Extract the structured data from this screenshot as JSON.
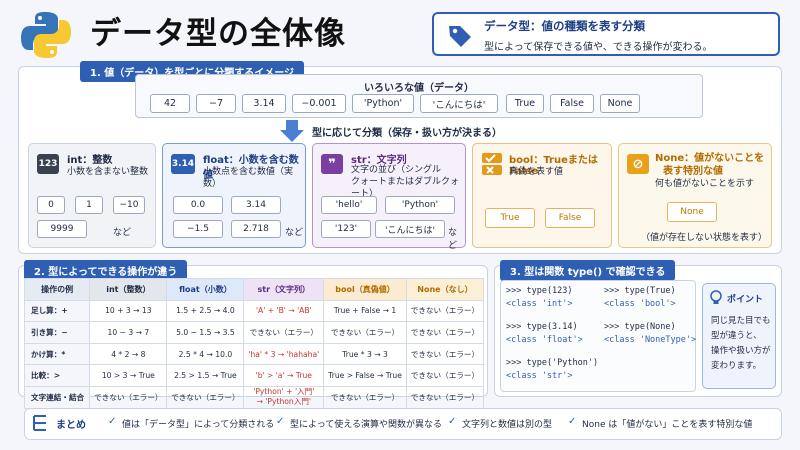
{
  "header": {
    "title": "データ型の全体像",
    "def_title": "データ型：値の種類を表す分類",
    "def_sub": "型によって保存できる値や、できる操作が変わる。"
  },
  "section1": {
    "label": "1. 値（データ）を型ごとに分類するイメージ",
    "values_heading": "いろいろな値（データ）",
    "values": [
      "42",
      "−7",
      "3.14",
      "−0.001",
      "'Python'",
      "'こんにちは'",
      "True",
      "False",
      "None"
    ],
    "arrow_text": "型に応じて分類（保存・扱い方が決まる）",
    "cards": {
      "int": {
        "icon": "123",
        "title": "int：整数",
        "desc": "小数を含まない整数",
        "vals": [
          "0",
          "1",
          "−10",
          "9999"
        ],
        "etc": "など"
      },
      "float": {
        "icon": "3.14",
        "title": "float：小数を含む数値",
        "desc": "小数点を含む数値（実数）",
        "vals": [
          "0.0",
          "3.14",
          "−1.5",
          "2.718"
        ],
        "etc": "など"
      },
      "str": {
        "title": "str：文字列",
        "desc1": "文字の並び（シングル",
        "desc2": "クォートまたはダブルクォート）",
        "vals": [
          "'hello'",
          "'Python'",
          "'123'",
          "'こんにちは'"
        ],
        "etc": "など"
      },
      "bool": {
        "title": "bool：TrueまたはFalse",
        "desc": "真偽を表す値",
        "vals": [
          "True",
          "False"
        ]
      },
      "none": {
        "title1": "None：値がないことを",
        "title2": "表す特別な値",
        "desc": "何も値がないことを示す",
        "val": "None",
        "note": "（値が存在しない状態を表す）"
      }
    }
  },
  "section2": {
    "label": "2. 型によってできる操作が違う",
    "headers": [
      "操作の例",
      "int（整数）",
      "float（小数）",
      "str（文字列）",
      "bool（真偽値）",
      "None（なし）"
    ],
    "rows": [
      [
        "足し算：+",
        "10 + 3 → 13",
        "1.5 + 2.5 → 4.0",
        "'A' + 'B' → 'AB'",
        "True + False → 1",
        "できない（エラー）"
      ],
      [
        "引き算：−",
        "10 − 3 → 7",
        "5.0 − 1.5 → 3.5",
        "できない（エラー）",
        "できない（エラー）",
        "できない（エラー）"
      ],
      [
        "かけ算：*",
        "4 * 2 → 8",
        "2.5 * 4 → 10.0",
        "'ha' * 3 → 'hahaha'",
        "True * 3 → 3",
        "できない（エラー）"
      ],
      [
        "比較：>",
        "10 > 3 → True",
        "2.5 > 1.5 → True",
        "'b' > 'a' → True",
        "True > False → True",
        "できない（エラー）"
      ],
      [
        "文字連結・結合",
        "できない（エラー）",
        "できない（エラー）",
        "'Python' + '入門'",
        "できない（エラー）",
        "できない（エラー）"
      ]
    ],
    "concat_result": "→ 'Python入門'"
  },
  "section3": {
    "label": "3. 型は関数 type() で確認できる",
    "code": {
      "l1": ">>> type(123)",
      "l1o": "<class 'int'>",
      "l2": ">>> type(3.14)",
      "l2o": "<class 'float'>",
      "l3": ">>> type('Python')",
      "l3o": "<class 'str'>",
      "r1": ">>> type(True)",
      "r1o": "<class 'bool'>",
      "r2": ">>> type(None)",
      "r2o": "<class 'NoneType'>"
    },
    "point_title": "ポイント",
    "point_lines": [
      "同じ見た目でも",
      "型が違うと、",
      "操作や扱い方が",
      "変わります。"
    ]
  },
  "summary": {
    "label": "まとめ",
    "items": [
      "値は「データ型」によって分類される",
      "型によって使える演算や関数が異なる",
      "文字列と数値は別の型",
      "None は「値がない」ことを表す特別な値"
    ]
  },
  "colors": {
    "primary": "#2f5fb3",
    "int": "#3a4250",
    "float": "#2f5fb3",
    "str": "#7b3fa0",
    "bool": "#e39a1c",
    "none": "#e8a21a"
  }
}
